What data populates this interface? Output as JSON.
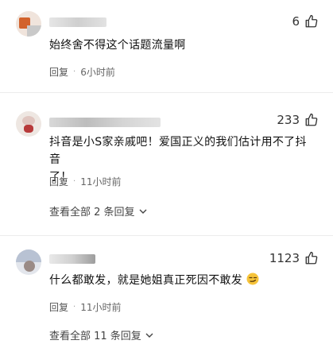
{
  "comments": [
    {
      "likes": "6",
      "text": "始终舍不得这个话题流量啊",
      "reply_label": "回复",
      "time": "6小时前"
    },
    {
      "likes": "233",
      "text_line1": "抖音是小S家亲戚吧！爱国正义的我们估计用不了抖音",
      "text_line2": "了！",
      "reply_label": "回复",
      "time": "11小时前",
      "view_all": "查看全部 2 条回复"
    },
    {
      "likes": "1123",
      "text": "什么都敢发，就是她姐真正死因不敢发",
      "reply_label": "回复",
      "time": "11小时前",
      "view_all": "查看全部 11 条回复"
    }
  ],
  "icons": {
    "like": "thumb-up-icon",
    "expand": "chevron-down-icon",
    "emoji": "smirk-emoji-icon"
  },
  "colors": {
    "accent_orange": "#d2622c",
    "text": "#111111",
    "meta": "#555555"
  }
}
